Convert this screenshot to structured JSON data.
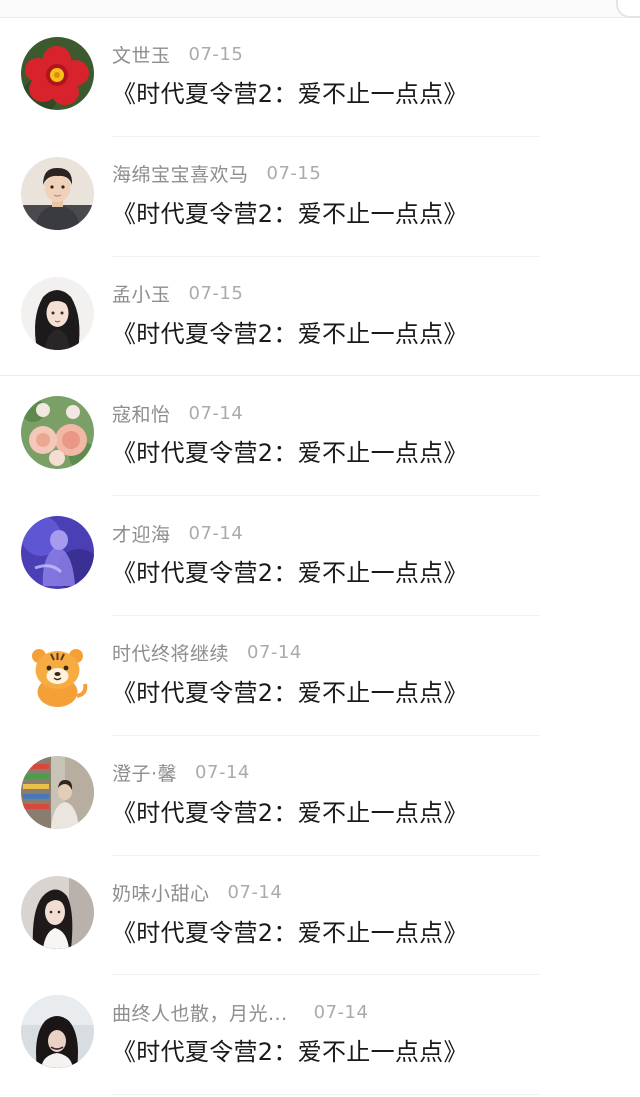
{
  "comments": [
    {
      "name": "文世玉",
      "date": "07-15",
      "text": "《时代夏令营2：爱不止一点点》",
      "avatar_icon": "red-flower-avatar"
    },
    {
      "name": "海绵宝宝喜欢马",
      "date": "07-15",
      "text": "《时代夏令营2：爱不止一点点》",
      "avatar_icon": "boy-portrait-avatar"
    },
    {
      "name": "孟小玉",
      "date": "07-15",
      "text": "《时代夏令营2：爱不止一点点》",
      "avatar_icon": "anime-girl-avatar"
    },
    {
      "name": "寇和怡",
      "date": "07-14",
      "text": "《时代夏令营2：爱不止一点点》",
      "avatar_icon": "roses-avatar"
    },
    {
      "name": "才迎海",
      "date": "07-14",
      "text": "《时代夏令营2：爱不止一点点》",
      "avatar_icon": "purple-figure-avatar"
    },
    {
      "name": "时代终将继续",
      "date": "07-14",
      "text": "《时代夏令营2：爱不止一点点》",
      "avatar_icon": "cartoon-tiger-avatar"
    },
    {
      "name": "澄子·馨",
      "date": "07-14",
      "text": "《时代夏令营2：爱不止一点点》",
      "avatar_icon": "store-photo-avatar"
    },
    {
      "name": "奶味小甜心",
      "date": "07-14",
      "text": "《时代夏令营2：爱不止一点点》",
      "avatar_icon": "girl-photo-avatar"
    },
    {
      "name": "曲终人也散，月光...",
      "date": "07-14",
      "text": "《时代夏令营2：爱不止一点点》",
      "avatar_icon": "dark-hair-girl-avatar"
    }
  ]
}
